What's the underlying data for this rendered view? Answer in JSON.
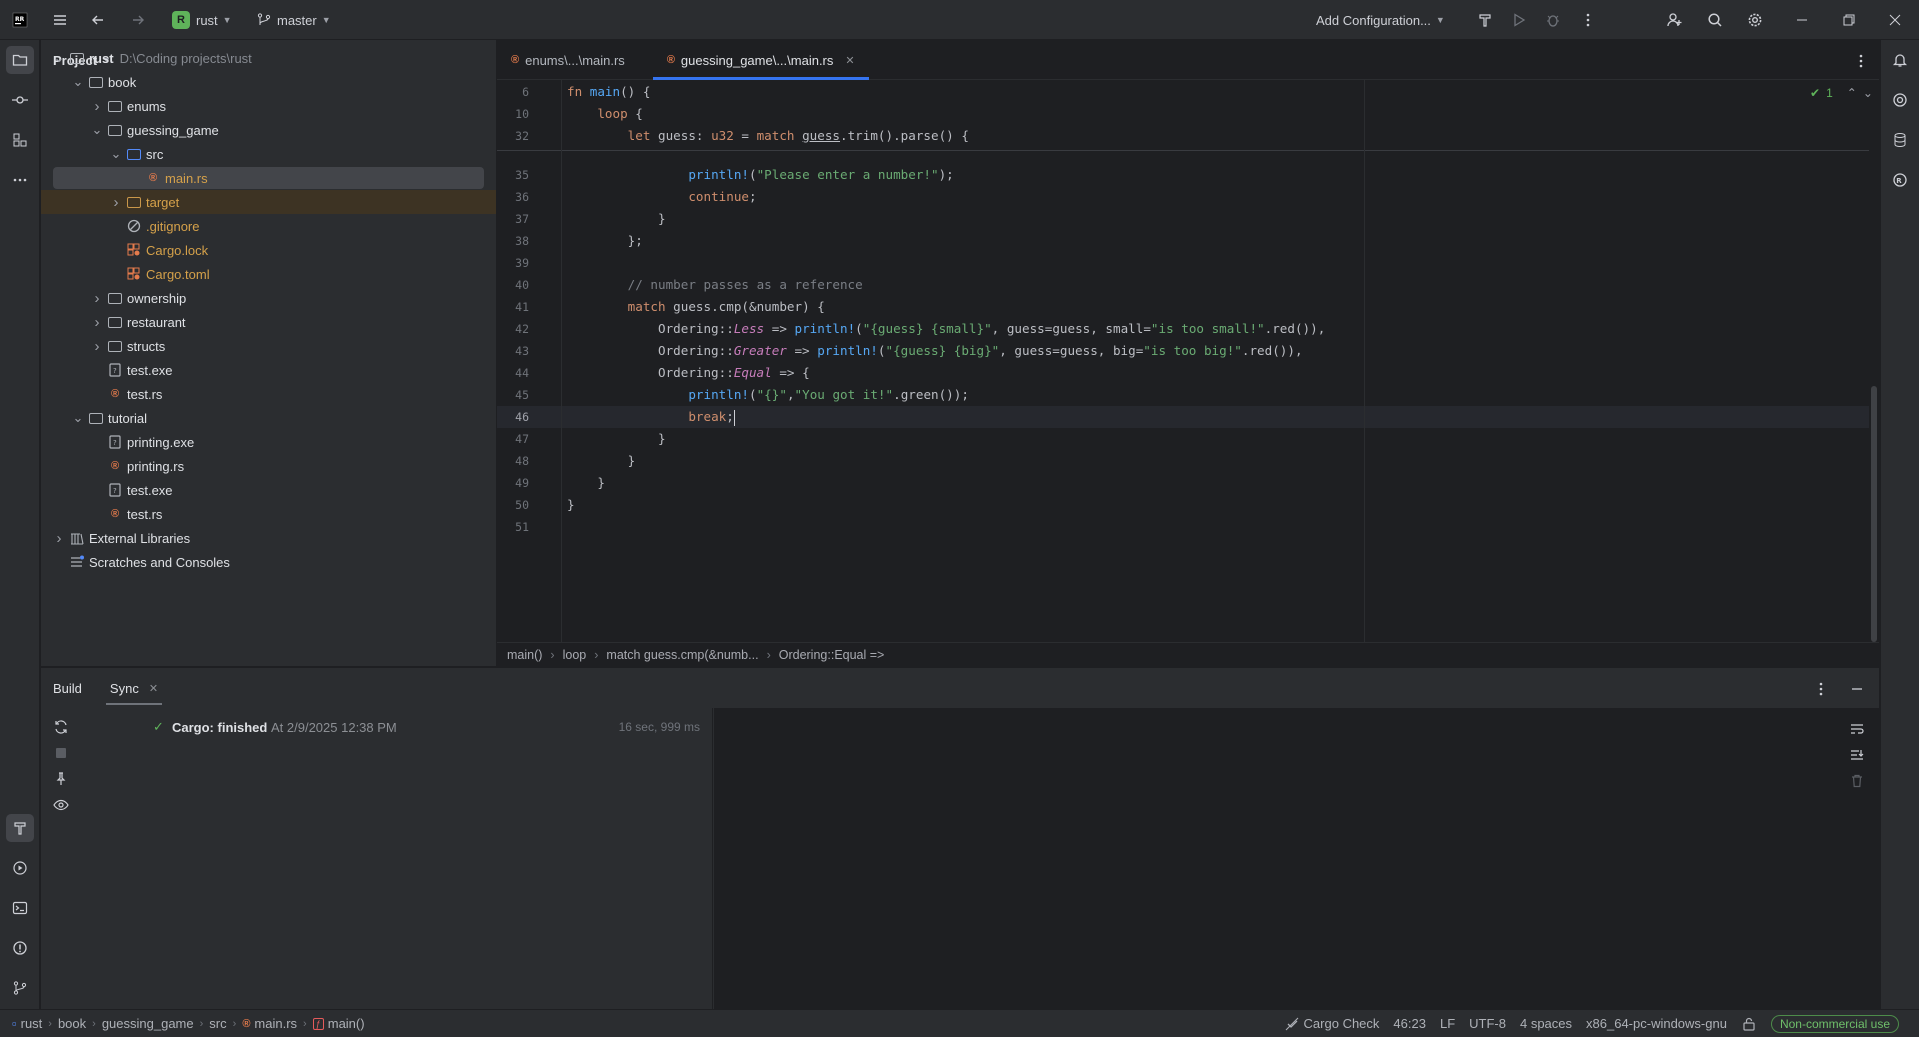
{
  "titlebar": {
    "project_badge": "R",
    "project_name": "rust",
    "branch": "master",
    "run_config": "Add Configuration..."
  },
  "project_panel": {
    "title": "Project",
    "tree": [
      {
        "label": "rust",
        "hint": "D:\\Coding projects\\rust",
        "type": "folder",
        "depth": 0,
        "expanded": true
      },
      {
        "label": "book",
        "type": "folder",
        "depth": 1,
        "expanded": true
      },
      {
        "label": "enums",
        "type": "folder",
        "depth": 2,
        "expanded": false
      },
      {
        "label": "guessing_game",
        "type": "folder",
        "depth": 2,
        "expanded": true
      },
      {
        "label": "src",
        "type": "folder-src",
        "depth": 3,
        "expanded": true
      },
      {
        "label": "main.rs",
        "type": "rust",
        "depth": 4,
        "selected": true
      },
      {
        "label": "target",
        "type": "folder-excluded",
        "depth": 3,
        "expanded": false
      },
      {
        "label": ".gitignore",
        "type": "gitignore",
        "depth": 3
      },
      {
        "label": "Cargo.lock",
        "type": "cargo",
        "depth": 3
      },
      {
        "label": "Cargo.toml",
        "type": "cargo",
        "depth": 3
      },
      {
        "label": "ownership",
        "type": "folder",
        "depth": 2,
        "expanded": false
      },
      {
        "label": "restaurant",
        "type": "folder",
        "depth": 2,
        "expanded": false
      },
      {
        "label": "structs",
        "type": "folder",
        "depth": 2,
        "expanded": false
      },
      {
        "label": "test.exe",
        "type": "file",
        "depth": 2
      },
      {
        "label": "test.rs",
        "type": "rust",
        "depth": 2
      },
      {
        "label": "tutorial",
        "type": "folder",
        "depth": 1,
        "expanded": true
      },
      {
        "label": "printing.exe",
        "type": "file",
        "depth": 2
      },
      {
        "label": "printing.rs",
        "type": "rust",
        "depth": 2
      },
      {
        "label": "test.exe",
        "type": "file",
        "depth": 2
      },
      {
        "label": "test.rs",
        "type": "rust",
        "depth": 2
      },
      {
        "label": "External Libraries",
        "type": "library",
        "depth": 0,
        "expanded": false
      },
      {
        "label": "Scratches and Consoles",
        "type": "scratches",
        "depth": 0
      }
    ]
  },
  "editor": {
    "tabs": [
      {
        "label": "enums\\...\\main.rs",
        "active": false
      },
      {
        "label": "guessing_game\\...\\main.rs",
        "active": true
      }
    ],
    "inspection_count": "1",
    "sticky_lines": [
      {
        "num": "6",
        "tokens": [
          [
            "kw",
            "fn "
          ],
          [
            "fn",
            "main"
          ],
          [
            "",
            "() {"
          ]
        ]
      },
      {
        "num": "10",
        "tokens": [
          [
            "",
            "    "
          ],
          [
            "kw",
            "loop"
          ],
          [
            "",
            " {"
          ]
        ]
      },
      {
        "num": "32",
        "tokens": [
          [
            "",
            "        "
          ],
          [
            "kw",
            "let "
          ],
          [
            "",
            "guess: "
          ],
          [
            "ty",
            "u32"
          ],
          [
            "",
            " = "
          ],
          [
            "kw",
            "match "
          ],
          [
            "ul",
            "guess"
          ],
          [
            "",
            ".trim().parse() {"
          ]
        ]
      }
    ],
    "lines": [
      {
        "num": "35",
        "tokens": [
          [
            "",
            "                "
          ],
          [
            "mac",
            "println!"
          ],
          [
            "",
            "("
          ],
          [
            "str",
            "\"Please enter a number!\""
          ],
          [
            "",
            ");"
          ]
        ]
      },
      {
        "num": "36",
        "tokens": [
          [
            "",
            "                "
          ],
          [
            "kw",
            "continue"
          ],
          [
            "",
            ";"
          ]
        ]
      },
      {
        "num": "37",
        "tokens": [
          [
            "",
            "            }"
          ]
        ]
      },
      {
        "num": "38",
        "tokens": [
          [
            "",
            "        };"
          ]
        ]
      },
      {
        "num": "39",
        "tokens": [
          [
            "",
            ""
          ]
        ]
      },
      {
        "num": "40",
        "tokens": [
          [
            "",
            "        "
          ],
          [
            "cm",
            "// number passes as a reference"
          ]
        ]
      },
      {
        "num": "41",
        "tokens": [
          [
            "",
            "        "
          ],
          [
            "kw",
            "match "
          ],
          [
            "",
            "guess.cmp(&number) {"
          ]
        ]
      },
      {
        "num": "42",
        "tokens": [
          [
            "",
            "            Ordering::"
          ],
          [
            "en",
            "Less"
          ],
          [
            "",
            " => "
          ],
          [
            "mac",
            "println!"
          ],
          [
            "",
            "("
          ],
          [
            "str",
            "\"{guess} {small}\""
          ],
          [
            "",
            ", guess=guess, small="
          ],
          [
            "str",
            "\"is too small!\""
          ],
          [
            "",
            ".red()),"
          ]
        ]
      },
      {
        "num": "43",
        "tokens": [
          [
            "",
            "            Ordering::"
          ],
          [
            "en",
            "Greater"
          ],
          [
            "",
            " => "
          ],
          [
            "mac",
            "println!"
          ],
          [
            "",
            "("
          ],
          [
            "str",
            "\"{guess} {big}\""
          ],
          [
            "",
            ", guess=guess, big="
          ],
          [
            "str",
            "\"is too big!\""
          ],
          [
            "",
            ".red()),"
          ]
        ]
      },
      {
        "num": "44",
        "tokens": [
          [
            "",
            "            Ordering::"
          ],
          [
            "en",
            "Equal"
          ],
          [
            "",
            " => {"
          ]
        ]
      },
      {
        "num": "45",
        "tokens": [
          [
            "",
            "                "
          ],
          [
            "mac",
            "println!"
          ],
          [
            "",
            "("
          ],
          [
            "str",
            "\"{}\""
          ],
          [
            "",
            ","
          ],
          [
            "str",
            "\"You got it!\""
          ],
          [
            "",
            ".green());"
          ]
        ]
      },
      {
        "num": "46",
        "tokens": [
          [
            "",
            "                "
          ],
          [
            "kw",
            "break"
          ],
          [
            "",
            ";"
          ]
        ],
        "current": true
      },
      {
        "num": "47",
        "tokens": [
          [
            "",
            "            }"
          ]
        ]
      },
      {
        "num": "48",
        "tokens": [
          [
            "",
            "        }"
          ]
        ]
      },
      {
        "num": "49",
        "tokens": [
          [
            "",
            "    }"
          ]
        ]
      },
      {
        "num": "50",
        "tokens": [
          [
            "",
            "}"
          ]
        ]
      },
      {
        "num": "51",
        "tokens": [
          [
            "",
            ""
          ]
        ]
      }
    ],
    "breadcrumbs": [
      "main()",
      "loop",
      "match guess.cmp(&numb...",
      "Ordering::Equal =>"
    ]
  },
  "build_panel": {
    "tabs": [
      {
        "label": "Build",
        "active": false
      },
      {
        "label": "Sync",
        "active": true
      }
    ],
    "entry": {
      "status": "Cargo: finished",
      "timestamp": "At 2/9/2025 12:38 PM",
      "duration": "16 sec, 999 ms"
    }
  },
  "statusbar": {
    "path": [
      "rust",
      "book",
      "guessing_game",
      "src",
      "main.rs",
      "main()"
    ],
    "cargo_check": "Cargo Check",
    "position": "46:23",
    "line_sep": "LF",
    "encoding": "UTF-8",
    "indent": "4 spaces",
    "toolchain": "x86_64-pc-windows-gnu",
    "license": "Non-commercial use"
  },
  "colors": {
    "accent": "#3574f0",
    "success": "#5fb35a",
    "rust_icon": "#e57b4c"
  }
}
